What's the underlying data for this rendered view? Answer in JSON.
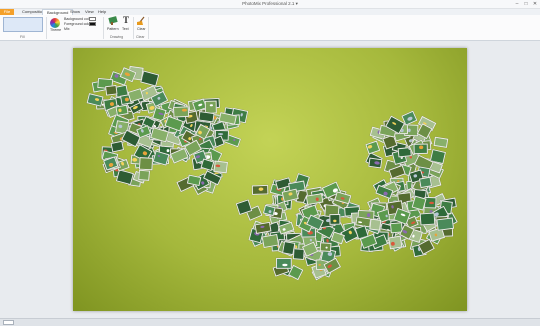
{
  "window": {
    "title": "PhotoMix Professional 2.1 ▾",
    "controls": [
      "–",
      "□",
      "✕"
    ]
  },
  "tabs": [
    {
      "label": "File"
    },
    {
      "label": "Composition"
    },
    {
      "label": "Background"
    },
    {
      "label": "Show"
    },
    {
      "label": "View"
    },
    {
      "label": "Help"
    }
  ],
  "ribbon": {
    "theme_label": "Theme",
    "background_color_label": "Background color",
    "foreground_color_label": "Foreground color",
    "mid_label": "Mix",
    "group_fill": "Fill",
    "group_drawing": "Drawing",
    "group_clear": "Clear",
    "pattern_label": "Pattern",
    "text_label": "Text",
    "clear_label": "Clear",
    "background_color": "#ffffff",
    "foreground_color": "#111111"
  },
  "colors": {
    "canvas_center": "#c3d356",
    "canvas_edge": "#7f9421",
    "accent_file_tab": "#f4a02a"
  },
  "icons": {
    "theme": "color-wheel-icon",
    "pattern": "pattern-brush-icon",
    "text": "text-tool-icon",
    "clear": "broom-icon"
  }
}
